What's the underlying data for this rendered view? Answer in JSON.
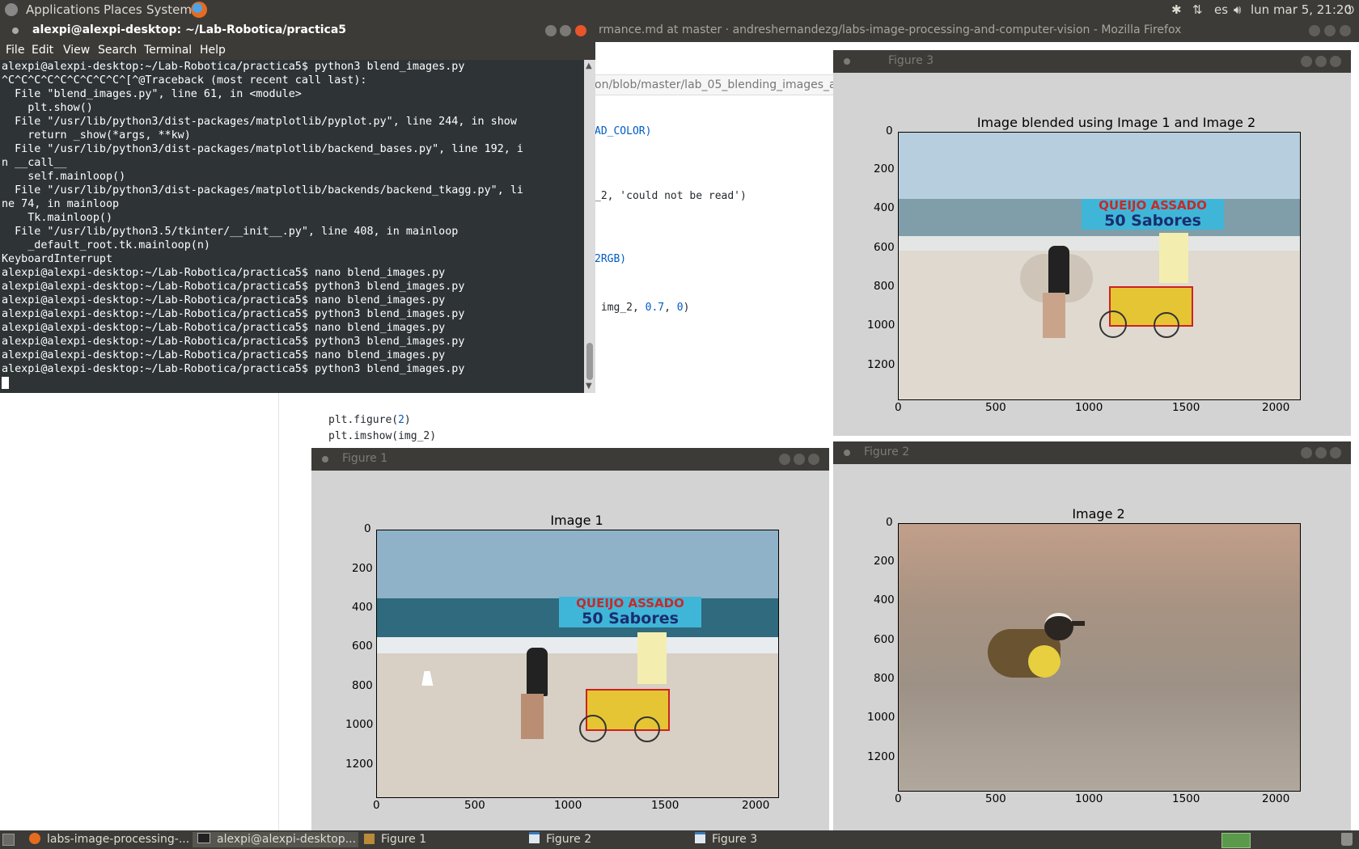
{
  "top_panel": {
    "menus": [
      "Applications",
      "Places",
      "System"
    ],
    "tray": {
      "lang": "es",
      "clock": "lun mar  5, 21:20"
    }
  },
  "firefox": {
    "title": "rmance.md at master · andreshernandezg/labs-image-processing-and-computer-vision - Mozilla Firefox",
    "url_fragment": "on/blob/master/lab_05_blending_images_a",
    "code_lines": [
      {
        "kind": "text",
        "text": "AD_COLOR)"
      },
      {
        "kind": "text",
        "text": "_2, 'could not be read')"
      },
      {
        "kind": "text",
        "text": "2RGB)"
      },
      {
        "kind": "addw",
        "pre": " img_2, ",
        "n1": "0.7",
        "mid": ", ",
        "n2": "0",
        "post": ")"
      },
      {
        "kind": "fig",
        "pre": "plt.figure(",
        "n": "2",
        "post": ")"
      },
      {
        "kind": "text",
        "text": "plt.imshow(img_2)"
      }
    ]
  },
  "terminal": {
    "title": "alexpi@alexpi-desktop: ~/Lab-Robotica/practica5",
    "menu": [
      "File",
      "Edit",
      "View",
      "Search",
      "Terminal",
      "Help"
    ],
    "lines": [
      "alexpi@alexpi-desktop:~/Lab-Robotica/practica5$ python3 blend_images.py",
      "^C^C^C^C^C^C^C^C^C^[^@Traceback (most recent call last):",
      "  File \"blend_images.py\", line 61, in <module>",
      "    plt.show()",
      "  File \"/usr/lib/python3/dist-packages/matplotlib/pyplot.py\", line 244, in show",
      "    return _show(*args, **kw)",
      "  File \"/usr/lib/python3/dist-packages/matplotlib/backend_bases.py\", line 192, i",
      "n __call__",
      "    self.mainloop()",
      "  File \"/usr/lib/python3/dist-packages/matplotlib/backends/backend_tkagg.py\", li",
      "ne 74, in mainloop",
      "    Tk.mainloop()",
      "  File \"/usr/lib/python3.5/tkinter/__init__.py\", line 408, in mainloop",
      "    _default_root.tk.mainloop(n)",
      "KeyboardInterrupt",
      "alexpi@alexpi-desktop:~/Lab-Robotica/practica5$ nano blend_images.py",
      "alexpi@alexpi-desktop:~/Lab-Robotica/practica5$ python3 blend_images.py",
      "alexpi@alexpi-desktop:~/Lab-Robotica/practica5$ nano blend_images.py",
      "alexpi@alexpi-desktop:~/Lab-Robotica/practica5$ python3 blend_images.py",
      "alexpi@alexpi-desktop:~/Lab-Robotica/practica5$ nano blend_images.py",
      "alexpi@alexpi-desktop:~/Lab-Robotica/practica5$ python3 blend_images.py",
      "alexpi@alexpi-desktop:~/Lab-Robotica/practica5$ nano blend_images.py",
      "alexpi@alexpi-desktop:~/Lab-Robotica/practica5$ python3 blend_images.py"
    ]
  },
  "figures": {
    "figure1": {
      "window_title": "Figure 1",
      "plot_title": "Image 1",
      "sign_top": "QUEIJO ASSADO",
      "sign_bottom": "50 Sabores"
    },
    "figure2": {
      "window_title": "Figure 2",
      "plot_title": "Image 2"
    },
    "figure3": {
      "window_title": "Figure 3",
      "plot_title": "Image blended using Image 1 and Image 2",
      "sign_top": "QUEIJO ASSADO",
      "sign_bottom": "50 Sabores"
    },
    "xticks": [
      "0",
      "500",
      "1000",
      "1500",
      "2000"
    ],
    "yticks": [
      "0",
      "200",
      "400",
      "600",
      "800",
      "1000",
      "1200"
    ]
  },
  "taskbar": {
    "items": [
      "labs-image-processing-...",
      "alexpi@alexpi-desktop...",
      "Figure 1",
      "Figure 2",
      "Figure 3"
    ]
  }
}
